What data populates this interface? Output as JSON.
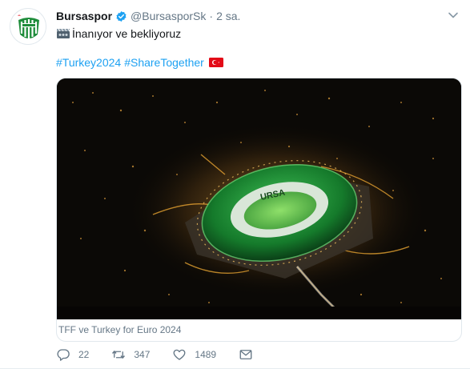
{
  "tweet": {
    "author_name": "Bursaspor",
    "author_handle": "@BursasporSk",
    "separator": "·",
    "time": "2 sa.",
    "text": "İnanıyor ve bekliyoruz",
    "hashtags": [
      "#Turkey2024",
      "#ShareTogether"
    ],
    "card_caption": "TFF ve Turkey for Euro 2024",
    "stadium_sign": "URSA"
  },
  "actions": {
    "replies": "22",
    "retweets": "347",
    "likes": "1489"
  },
  "icons": {
    "verified": "verified-badge-icon",
    "caret": "chevron-down-icon",
    "emoji": "cinema-clapper-icon",
    "flag": "turkey-flag-icon",
    "reply": "reply-icon",
    "retweet": "retweet-icon",
    "like": "heart-icon",
    "dm": "envelope-icon"
  },
  "colors": {
    "link": "#1da1f2",
    "muted": "#657786",
    "verified": "#1da1f2",
    "club_green": "#1e8c3a"
  }
}
